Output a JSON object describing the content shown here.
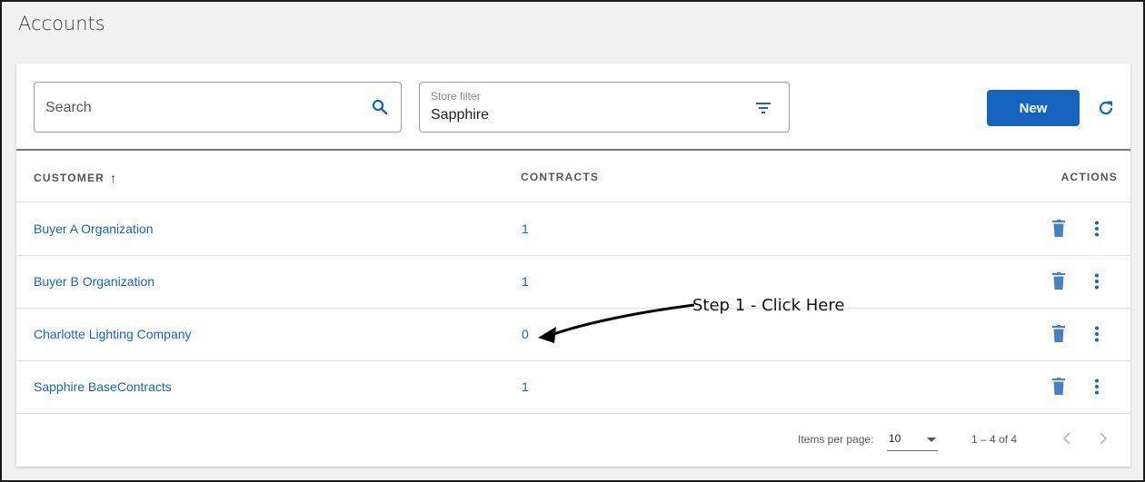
{
  "page": {
    "title": "Accounts"
  },
  "toolbar": {
    "search_placeholder": "Search",
    "store_filter_label": "Store filter",
    "store_filter_value": "Sapphire",
    "new_label": "New"
  },
  "table": {
    "headers": {
      "customer": "CUSTOMER",
      "contracts": "CONTRACTS",
      "actions": "ACTIONS"
    },
    "sort_indicator": "↑",
    "rows": [
      {
        "customer": "Buyer A Organization",
        "contracts": "1"
      },
      {
        "customer": "Buyer B Organization",
        "contracts": "1"
      },
      {
        "customer": "Charlotte Lighting Company",
        "contracts": "0"
      },
      {
        "customer": "Sapphire BaseContracts",
        "contracts": "1"
      }
    ]
  },
  "paginator": {
    "items_per_page_label": "Items per page:",
    "items_per_page_value": "10",
    "range_label": "1 – 4 of 4"
  },
  "annotation": {
    "text": "Step 1 - Click Here"
  },
  "icons": {
    "search": "search-icon",
    "filter": "filter-icon",
    "refresh": "refresh-icon",
    "delete": "trash-icon",
    "more": "kebab-menu-icon",
    "prev": "chevron-left-icon",
    "next": "chevron-right-icon",
    "sort": "sort-ascending-icon"
  },
  "colors": {
    "primary": "#1565c0",
    "action_icon": "#4a7fc1",
    "disabled": "#bdbdbd"
  }
}
